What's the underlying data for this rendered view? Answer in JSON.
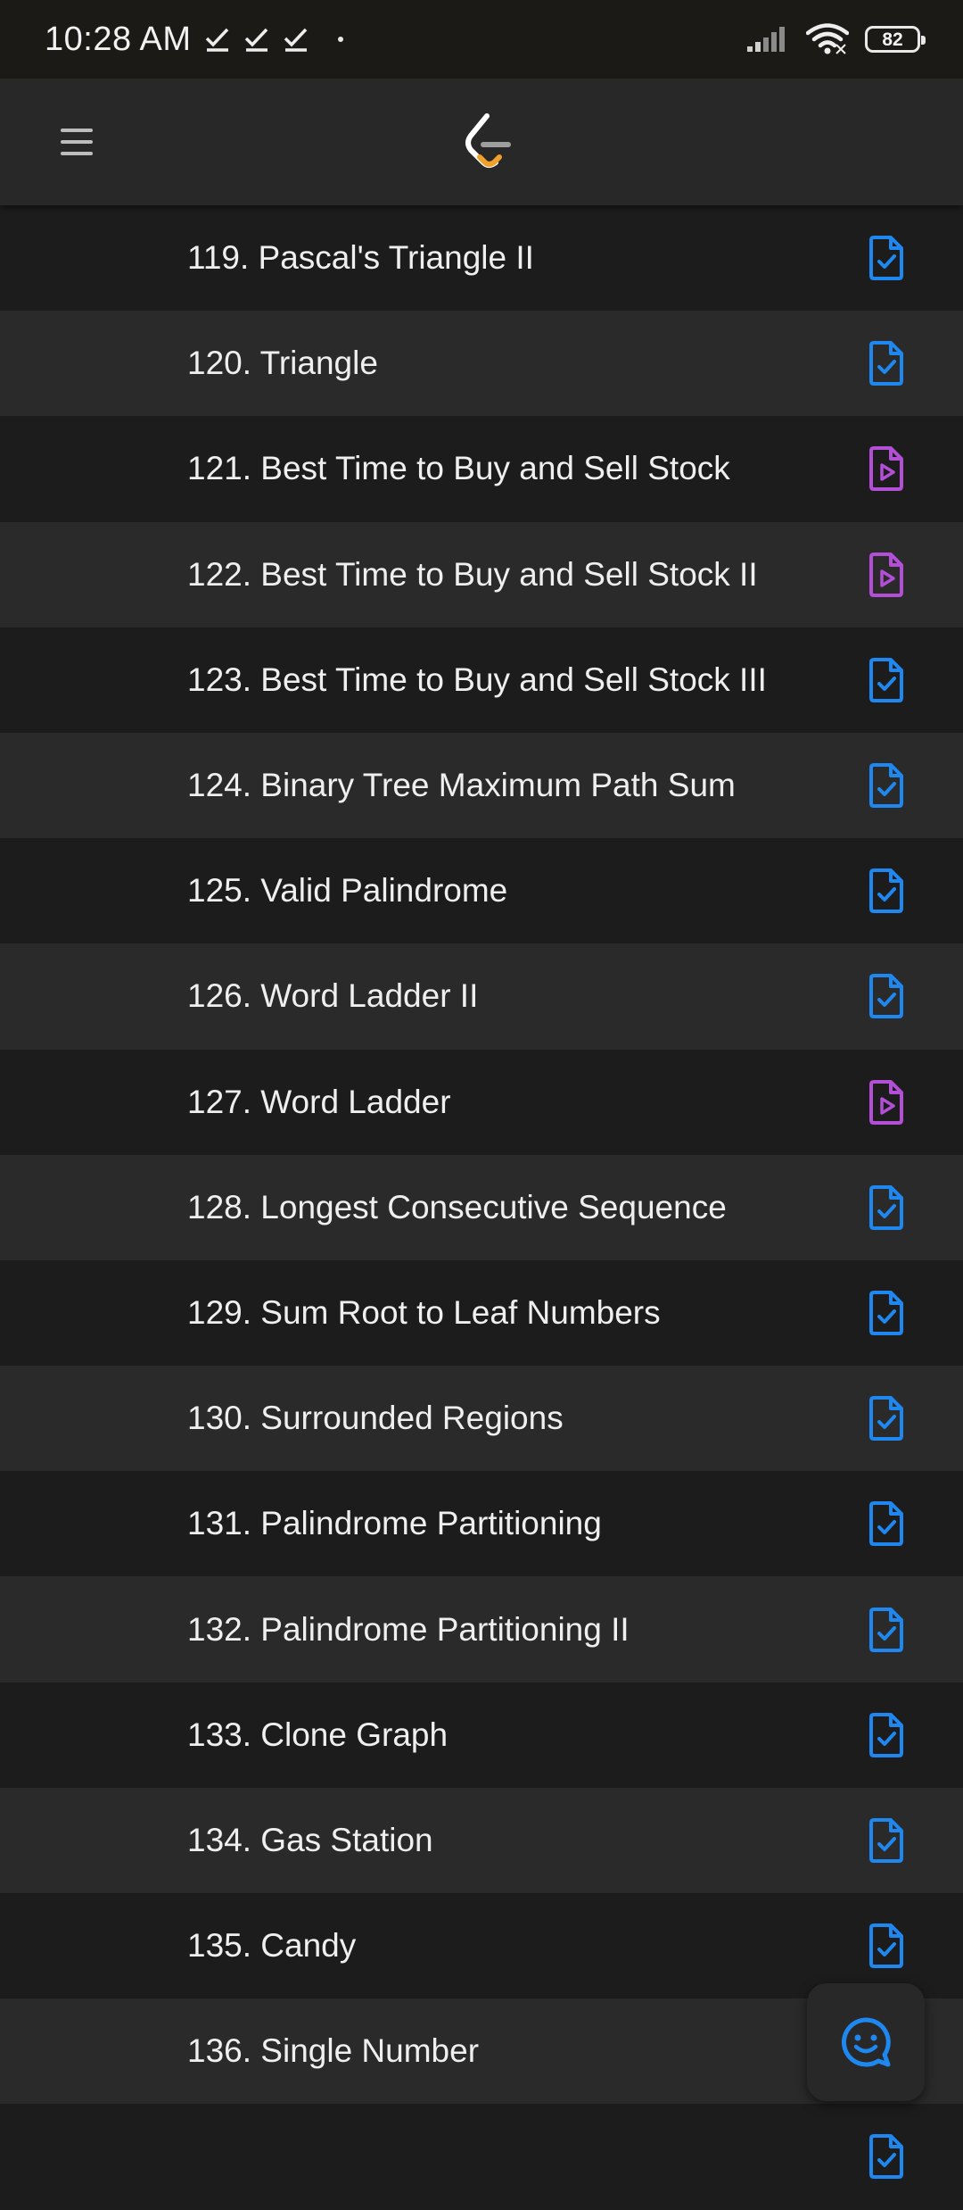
{
  "status_bar": {
    "time": "10:28 AM",
    "notification_icons": [
      "check-notification-icon",
      "check-notification-icon",
      "check-notification-icon",
      "dot-notification-icon"
    ],
    "battery": "82",
    "signal_icon": "cellular-signal-icon",
    "wifi_icon": "wifi-icon"
  },
  "app_bar": {
    "menu_icon": "hamburger-menu-icon",
    "logo_icon": "leetcode-logo-icon"
  },
  "colors": {
    "solution_icon": "#1e88f0",
    "video_icon": "#b24fd6",
    "row_dark": "#1c1c1c",
    "row_light": "#2a2a2a"
  },
  "problems": [
    {
      "title": "119. Pascal's Triangle II",
      "icon": "solution-check-icon"
    },
    {
      "title": "120. Triangle",
      "icon": "solution-check-icon"
    },
    {
      "title": "121. Best Time to Buy and Sell Stock",
      "icon": "video-solution-icon"
    },
    {
      "title": "122. Best Time to Buy and Sell Stock II",
      "icon": "video-solution-icon"
    },
    {
      "title": "123. Best Time to Buy and Sell Stock III",
      "icon": "solution-check-icon"
    },
    {
      "title": "124. Binary Tree Maximum Path Sum",
      "icon": "solution-check-icon"
    },
    {
      "title": "125. Valid Palindrome",
      "icon": "solution-check-icon"
    },
    {
      "title": "126. Word Ladder II",
      "icon": "solution-check-icon"
    },
    {
      "title": "127. Word Ladder",
      "icon": "video-solution-icon"
    },
    {
      "title": "128. Longest Consecutive Sequence",
      "icon": "solution-check-icon"
    },
    {
      "title": "129. Sum Root to Leaf Numbers",
      "icon": "solution-check-icon"
    },
    {
      "title": "130. Surrounded Regions",
      "icon": "solution-check-icon"
    },
    {
      "title": "131. Palindrome Partitioning",
      "icon": "solution-check-icon"
    },
    {
      "title": "132. Palindrome Partitioning II",
      "icon": "solution-check-icon"
    },
    {
      "title": "133. Clone Graph",
      "icon": "solution-check-icon"
    },
    {
      "title": "134. Gas Station",
      "icon": "solution-check-icon"
    },
    {
      "title": "135. Candy",
      "icon": "solution-check-icon"
    },
    {
      "title": "136. Single Number",
      "icon": "solution-check-icon"
    },
    {
      "title": "",
      "icon": "solution-check-icon"
    }
  ],
  "fab": {
    "icon": "chat-smiley-icon"
  }
}
